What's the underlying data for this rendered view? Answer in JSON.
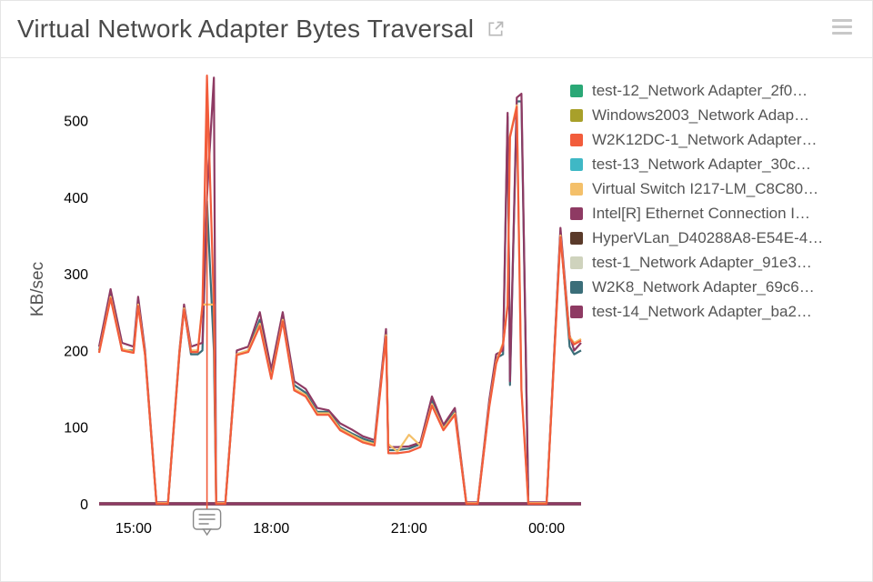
{
  "title": "Virtual Network Adapter Bytes Traversal",
  "ylabel": "KB/sec",
  "legend": [
    {
      "label": "test-12_Network Adapter_2f0…",
      "color": "#2aa876"
    },
    {
      "label": "Windows2003_Network Adap…",
      "color": "#a8a02a"
    },
    {
      "label": "W2K12DC-1_Network Adapter…",
      "color": "#f25c3b"
    },
    {
      "label": "test-13_Network Adapter_30c…",
      "color": "#3fb8c5"
    },
    {
      "label": "Virtual Switch I217-LM_C8C80…",
      "color": "#f4c06a"
    },
    {
      "label": "Intel[R] Ethernet Connection I…",
      "color": "#8e3a63"
    },
    {
      "label": "HyperVLan_D40288A8-E54E-4…",
      "color": "#5a3a2a"
    },
    {
      "label": "test-1_Network Adapter_91e3…",
      "color": "#cfd3bd"
    },
    {
      "label": "W2K8_Network Adapter_69c6…",
      "color": "#3b6e79"
    },
    {
      "label": "test-14_Network Adapter_ba2…",
      "color": "#8e3a63"
    }
  ],
  "chart_data": {
    "type": "line",
    "xlabel": "",
    "ylabel": "KB/sec",
    "title": "Virtual Network Adapter Bytes Traversal",
    "x_ticks": [
      "15:00",
      "18:00",
      "21:00",
      "00:00"
    ],
    "y_ticks": [
      0,
      100,
      200,
      300,
      400,
      500
    ],
    "xlim": [
      14.25,
      24.75
    ],
    "ylim": [
      0,
      560
    ],
    "annotation_x": 16.6,
    "x": [
      14.25,
      14.5,
      14.75,
      15,
      15.1,
      15.25,
      15.5,
      15.75,
      16,
      16.1,
      16.25,
      16.4,
      16.5,
      16.6,
      16.75,
      16.8,
      17,
      17.25,
      17.5,
      17.75,
      18,
      18.25,
      18.5,
      18.75,
      19,
      19.25,
      19.5,
      19.75,
      20,
      20.25,
      20.5,
      20.55,
      20.75,
      21,
      21.25,
      21.5,
      21.75,
      22,
      22.25,
      22.5,
      22.75,
      22.9,
      23.05,
      23.15,
      23.2,
      23.35,
      23.45,
      23.6,
      23.7,
      24,
      24.3,
      24.5,
      24.6,
      24.75
    ],
    "series": [
      {
        "name": "W2K8_Network Adapter_69c6…",
        "color": "#3b6e79",
        "values": [
          200,
          275,
          200,
          200,
          265,
          195,
          0,
          0,
          195,
          255,
          195,
          195,
          200,
          395,
          200,
          0,
          0,
          195,
          200,
          240,
          170,
          245,
          155,
          145,
          120,
          120,
          100,
          92,
          85,
          80,
          225,
          70,
          70,
          72,
          78,
          135,
          100,
          120,
          0,
          0,
          130,
          190,
          195,
          505,
          155,
          525,
          525,
          0,
          0,
          0,
          355,
          205,
          195,
          200
        ]
      },
      {
        "name": "Intel[R] Ethernet Connection I…",
        "color": "#8e3a63",
        "values": [
          205,
          280,
          210,
          205,
          270,
          200,
          2,
          2,
          200,
          260,
          205,
          208,
          210,
          400,
          556,
          2,
          2,
          200,
          205,
          250,
          175,
          250,
          160,
          150,
          125,
          122,
          105,
          97,
          88,
          83,
          228,
          74,
          74,
          75,
          80,
          140,
          103,
          125,
          2,
          2,
          135,
          195,
          200,
          510,
          160,
          530,
          535,
          2,
          2,
          2,
          360,
          220,
          200,
          210
        ]
      },
      {
        "name": "Virtual Switch I217-LM_C8C80…",
        "color": "#f4c06a",
        "values": [
          198,
          270,
          202,
          198,
          260,
          195,
          1,
          1,
          198,
          255,
          200,
          200,
          260,
          260,
          260,
          1,
          1,
          195,
          200,
          235,
          165,
          240,
          150,
          142,
          118,
          118,
          98,
          90,
          82,
          78,
          220,
          78,
          68,
          90,
          76,
          130,
          98,
          118,
          1,
          1,
          128,
          185,
          210,
          260,
          480,
          520,
          150,
          1,
          1,
          1,
          350,
          218,
          210,
          215
        ]
      },
      {
        "name": "W2K12DC-1_Network Adapter…",
        "color": "#f25c3b",
        "values": [
          197,
          268,
          200,
          197,
          258,
          194,
          0,
          0,
          196,
          253,
          198,
          198,
          258,
          558,
          258,
          0,
          0,
          194,
          198,
          232,
          163,
          238,
          148,
          140,
          116,
          116,
          96,
          88,
          80,
          76,
          218,
          66,
          66,
          68,
          74,
          128,
          96,
          116,
          0,
          0,
          126,
          183,
          208,
          258,
          478,
          518,
          148,
          0,
          0,
          0,
          348,
          216,
          208,
          213
        ]
      },
      {
        "name": "test-12_Network Adapter_2f0…",
        "color": "#2aa876",
        "values": [
          0,
          0,
          0,
          0,
          0,
          0,
          0,
          0,
          0,
          0,
          0,
          0,
          0,
          0,
          0,
          0,
          0,
          0,
          0,
          0,
          0,
          0,
          0,
          0,
          0,
          0,
          0,
          0,
          0,
          0,
          0,
          0,
          0,
          0,
          0,
          0,
          0,
          0,
          0,
          0,
          0,
          0,
          0,
          0,
          0,
          0,
          0,
          0,
          0,
          0,
          0,
          0,
          0,
          0
        ]
      },
      {
        "name": "Windows2003_Network Adap…",
        "color": "#a8a02a",
        "values": [
          0,
          0,
          0,
          0,
          0,
          0,
          0,
          0,
          0,
          0,
          0,
          0,
          0,
          0,
          0,
          0,
          0,
          0,
          0,
          0,
          0,
          0,
          0,
          0,
          0,
          0,
          0,
          0,
          0,
          0,
          0,
          0,
          0,
          0,
          0,
          0,
          0,
          0,
          0,
          0,
          0,
          0,
          0,
          0,
          0,
          0,
          0,
          0,
          0,
          0,
          0,
          0,
          0,
          0
        ]
      },
      {
        "name": "test-13_Network Adapter_30c…",
        "color": "#3fb8c5",
        "values": [
          0,
          0,
          0,
          0,
          0,
          0,
          0,
          0,
          0,
          0,
          0,
          0,
          0,
          0,
          0,
          0,
          0,
          0,
          0,
          0,
          0,
          0,
          0,
          0,
          0,
          0,
          0,
          0,
          0,
          0,
          0,
          0,
          0,
          0,
          0,
          0,
          0,
          0,
          0,
          0,
          0,
          0,
          0,
          0,
          0,
          0,
          0,
          0,
          0,
          0,
          0,
          0,
          0,
          0
        ]
      },
      {
        "name": "HyperVLan_D40288A8-E54E-4…",
        "color": "#5a3a2a",
        "values": [
          0,
          0,
          0,
          0,
          0,
          0,
          0,
          0,
          0,
          0,
          0,
          0,
          0,
          0,
          0,
          0,
          0,
          0,
          0,
          0,
          0,
          0,
          0,
          0,
          0,
          0,
          0,
          0,
          0,
          0,
          0,
          0,
          0,
          0,
          0,
          0,
          0,
          0,
          0,
          0,
          0,
          0,
          0,
          0,
          0,
          0,
          0,
          0,
          0,
          0,
          0,
          0,
          0,
          0
        ]
      },
      {
        "name": "test-1_Network Adapter_91e3…",
        "color": "#cfd3bd",
        "values": [
          0,
          0,
          0,
          0,
          0,
          0,
          0,
          0,
          0,
          0,
          0,
          0,
          0,
          0,
          0,
          0,
          0,
          0,
          0,
          0,
          0,
          0,
          0,
          0,
          0,
          0,
          0,
          0,
          0,
          0,
          0,
          0,
          0,
          0,
          0,
          0,
          0,
          0,
          0,
          0,
          0,
          0,
          0,
          0,
          0,
          0,
          0,
          0,
          0,
          0,
          0,
          0,
          0,
          0
        ]
      },
      {
        "name": "test-14_Network Adapter_ba2…",
        "color": "#8e3a63",
        "values": [
          0,
          0,
          0,
          0,
          0,
          0,
          0,
          0,
          0,
          0,
          0,
          0,
          0,
          0,
          0,
          0,
          0,
          0,
          0,
          0,
          0,
          0,
          0,
          0,
          0,
          0,
          0,
          0,
          0,
          0,
          0,
          0,
          0,
          0,
          0,
          0,
          0,
          0,
          0,
          0,
          0,
          0,
          0,
          0,
          0,
          0,
          0,
          0,
          0,
          0,
          0,
          0,
          0,
          0
        ]
      }
    ]
  }
}
